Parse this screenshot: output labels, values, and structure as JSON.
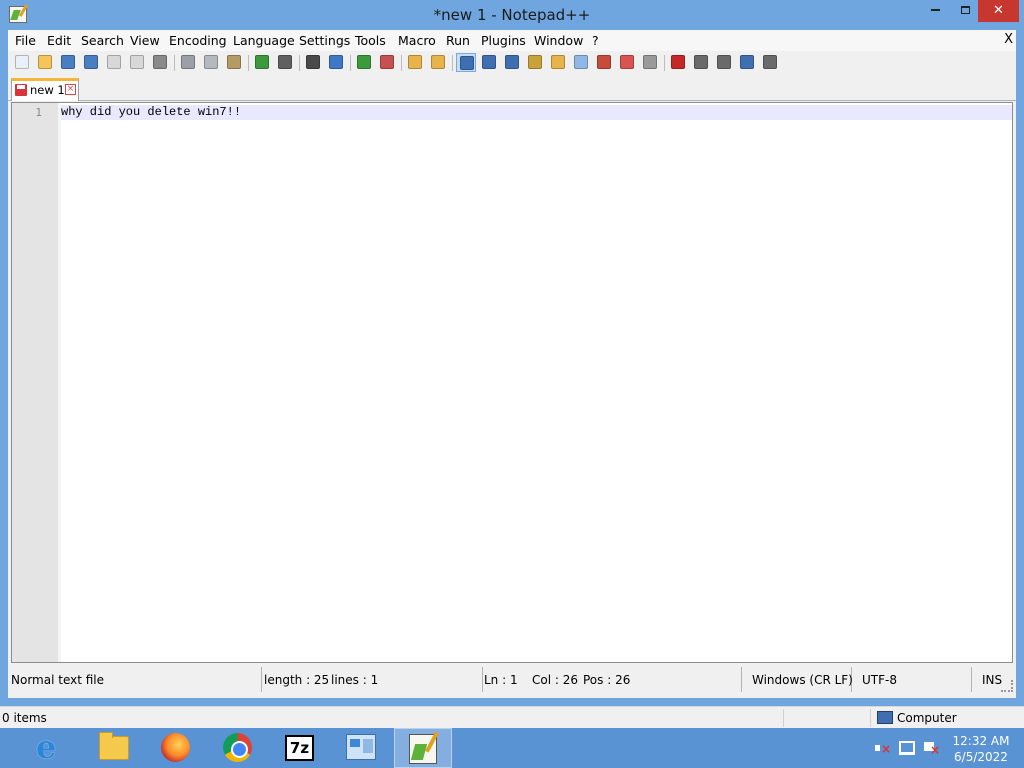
{
  "window": {
    "title": "*new 1 - Notepad++",
    "close_glyph": "✕"
  },
  "menu": {
    "items": [
      "File",
      "Edit",
      "Search",
      "View",
      "Encoding",
      "Language",
      "Settings",
      "Tools",
      "Macro",
      "Run",
      "Plugins",
      "Window",
      "?"
    ],
    "close_label": "X"
  },
  "toolbar": {
    "buttons": [
      {
        "name": "new-file-icon",
        "color": "#e9f0f8"
      },
      {
        "name": "open-file-icon",
        "color": "#f3c55a"
      },
      {
        "name": "save-icon",
        "color": "#4a7ec2"
      },
      {
        "name": "save-all-icon",
        "color": "#4a7ec2"
      },
      {
        "name": "close-icon",
        "color": "#d8d8d8"
      },
      {
        "name": "close-all-icon",
        "color": "#d8d8d8"
      },
      {
        "name": "print-icon",
        "color": "#8a8a8a"
      },
      {
        "name": "cut-icon",
        "color": "#9aa0a6"
      },
      {
        "name": "copy-icon",
        "color": "#b5b9bf"
      },
      {
        "name": "paste-icon",
        "color": "#b59a64"
      },
      {
        "name": "undo-icon",
        "color": "#3c9a3c"
      },
      {
        "name": "redo-icon",
        "color": "#606060"
      },
      {
        "name": "find-icon",
        "color": "#4a4a4a"
      },
      {
        "name": "replace-icon",
        "color": "#3f78c7"
      },
      {
        "name": "zoom-in-icon",
        "color": "#3c9a3c"
      },
      {
        "name": "zoom-out-icon",
        "color": "#c75050"
      },
      {
        "name": "sync-vertical-icon",
        "color": "#e8b34a"
      },
      {
        "name": "sync-horizontal-icon",
        "color": "#e8b34a"
      },
      {
        "name": "word-wrap-icon",
        "color": "#3f6fb0"
      },
      {
        "name": "show-all-characters-icon",
        "color": "#3f6fb0"
      },
      {
        "name": "indent-guide-icon",
        "color": "#3f6fb0"
      },
      {
        "name": "user-language-icon",
        "color": "#c9a23a"
      },
      {
        "name": "document-map-icon",
        "color": "#e8b34a"
      },
      {
        "name": "document-list-icon",
        "color": "#8fb8e6"
      },
      {
        "name": "function-list-icon",
        "color": "#c84a3a"
      },
      {
        "name": "folder-workspace-icon",
        "color": "#d9534f"
      },
      {
        "name": "monitoring-icon",
        "color": "#9a9a9a"
      },
      {
        "name": "record-macro-icon",
        "color": "#c62828"
      },
      {
        "name": "stop-recording-icon",
        "color": "#6a6a6a"
      },
      {
        "name": "playback-macro-icon",
        "color": "#6a6a6a"
      },
      {
        "name": "run-macro-multiple-icon",
        "color": "#3f6fb0"
      },
      {
        "name": "save-macro-icon",
        "color": "#6a6a6a"
      }
    ]
  },
  "tabs": [
    {
      "label": "new 1",
      "close_glyph": "×"
    }
  ],
  "editor": {
    "lines": [
      {
        "number": "1",
        "text": "why did you delete win7!!"
      }
    ]
  },
  "status": {
    "file_type": "Normal text file",
    "length": "length : 25",
    "lines": "lines : 1",
    "ln": "Ln : 1",
    "col": "Col : 26",
    "pos": "Pos : 26",
    "eol": "Windows (CR LF)",
    "encoding": "UTF-8",
    "mode": "INS"
  },
  "explorer_status": {
    "items": "0 items",
    "location": "Computer"
  },
  "taskbar": {
    "zip_label": "7z",
    "time": "12:32 AM",
    "date": "6/5/2022"
  }
}
